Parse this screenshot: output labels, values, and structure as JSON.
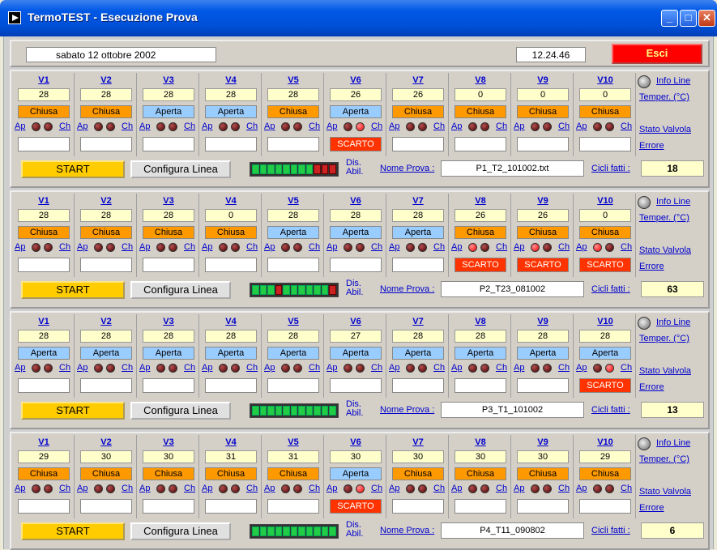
{
  "window": {
    "title": "TermoTEST - Esecuzione Prova",
    "minimize": "_",
    "maximize": "□",
    "close": "✕"
  },
  "header": {
    "date": "sabato 12 ottobre 2002",
    "time": "12.24.46",
    "exit_label": "Esci"
  },
  "labels": {
    "info_line": "Info Line",
    "temper": "Temper. (°C)",
    "stato_valvola": "Stato Valvola",
    "errore": "Errore",
    "start": "START",
    "configura": "Configura Linea",
    "dis": "Dis.",
    "abil": "Abil.",
    "nome_prova": "Nome Prova :",
    "cicli_fatti": "Cicli fatti :",
    "ap": "Ap",
    "ch": "Ch"
  },
  "colors": {
    "chiusa": "#ff9900",
    "aperta": "#99ccff",
    "scarto": "#ff3300",
    "start": "#ffcc00",
    "exit": "#ff0000"
  },
  "lines": [
    {
      "nome_prova": "P1_T2_101002.txt",
      "cicli_fatti": "18",
      "abil": [
        1,
        1,
        1,
        1,
        1,
        1,
        1,
        1,
        0,
        0,
        0
      ],
      "valves": [
        {
          "name": "V1",
          "temp": "28",
          "state": "Chiusa",
          "ap": 0,
          "ch": 0,
          "err": ""
        },
        {
          "name": "V2",
          "temp": "28",
          "state": "Chiusa",
          "ap": 0,
          "ch": 0,
          "err": ""
        },
        {
          "name": "V3",
          "temp": "28",
          "state": "Aperta",
          "ap": 0,
          "ch": 0,
          "err": ""
        },
        {
          "name": "V4",
          "temp": "28",
          "state": "Aperta",
          "ap": 0,
          "ch": 0,
          "err": ""
        },
        {
          "name": "V5",
          "temp": "28",
          "state": "Chiusa",
          "ap": 0,
          "ch": 0,
          "err": ""
        },
        {
          "name": "V6",
          "temp": "26",
          "state": "Aperta",
          "ap": 0,
          "ch": 1,
          "err": "SCARTO"
        },
        {
          "name": "V7",
          "temp": "26",
          "state": "Chiusa",
          "ap": 0,
          "ch": 0,
          "err": ""
        },
        {
          "name": "V8",
          "temp": "0",
          "state": "Chiusa",
          "ap": 0,
          "ch": 0,
          "err": ""
        },
        {
          "name": "V9",
          "temp": "0",
          "state": "Chiusa",
          "ap": 0,
          "ch": 0,
          "err": ""
        },
        {
          "name": "V10",
          "temp": "0",
          "state": "Chiusa",
          "ap": 0,
          "ch": 0,
          "err": ""
        }
      ]
    },
    {
      "nome_prova": "P2_T23_081002",
      "cicli_fatti": "63",
      "abil": [
        1,
        1,
        1,
        0,
        1,
        1,
        1,
        1,
        1,
        1,
        0
      ],
      "valves": [
        {
          "name": "V1",
          "temp": "28",
          "state": "Chiusa",
          "ap": 0,
          "ch": 0,
          "err": ""
        },
        {
          "name": "V2",
          "temp": "28",
          "state": "Chiusa",
          "ap": 0,
          "ch": 0,
          "err": ""
        },
        {
          "name": "V3",
          "temp": "28",
          "state": "Chiusa",
          "ap": 0,
          "ch": 0,
          "err": ""
        },
        {
          "name": "V4",
          "temp": "0",
          "state": "Chiusa",
          "ap": 0,
          "ch": 0,
          "err": ""
        },
        {
          "name": "V5",
          "temp": "28",
          "state": "Aperta",
          "ap": 0,
          "ch": 0,
          "err": ""
        },
        {
          "name": "V6",
          "temp": "28",
          "state": "Aperta",
          "ap": 0,
          "ch": 0,
          "err": ""
        },
        {
          "name": "V7",
          "temp": "28",
          "state": "Aperta",
          "ap": 0,
          "ch": 0,
          "err": ""
        },
        {
          "name": "V8",
          "temp": "26",
          "state": "Chiusa",
          "ap": 1,
          "ch": 0,
          "err": "SCARTO"
        },
        {
          "name": "V9",
          "temp": "26",
          "state": "Chiusa",
          "ap": 1,
          "ch": 0,
          "err": "SCARTO"
        },
        {
          "name": "V10",
          "temp": "0",
          "state": "Chiusa",
          "ap": 1,
          "ch": 0,
          "err": "SCARTO"
        }
      ]
    },
    {
      "nome_prova": "P3_T1_101002",
      "cicli_fatti": "13",
      "abil": [
        1,
        1,
        1,
        1,
        1,
        1,
        1,
        1,
        1,
        1,
        1
      ],
      "valves": [
        {
          "name": "V1",
          "temp": "28",
          "state": "Aperta",
          "ap": 0,
          "ch": 0,
          "err": ""
        },
        {
          "name": "V2",
          "temp": "28",
          "state": "Aperta",
          "ap": 0,
          "ch": 0,
          "err": ""
        },
        {
          "name": "V3",
          "temp": "28",
          "state": "Aperta",
          "ap": 0,
          "ch": 0,
          "err": ""
        },
        {
          "name": "V4",
          "temp": "28",
          "state": "Aperta",
          "ap": 0,
          "ch": 0,
          "err": ""
        },
        {
          "name": "V5",
          "temp": "28",
          "state": "Aperta",
          "ap": 0,
          "ch": 0,
          "err": ""
        },
        {
          "name": "V6",
          "temp": "27",
          "state": "Aperta",
          "ap": 0,
          "ch": 0,
          "err": ""
        },
        {
          "name": "V7",
          "temp": "28",
          "state": "Aperta",
          "ap": 0,
          "ch": 0,
          "err": ""
        },
        {
          "name": "V8",
          "temp": "28",
          "state": "Aperta",
          "ap": 0,
          "ch": 0,
          "err": ""
        },
        {
          "name": "V9",
          "temp": "28",
          "state": "Aperta",
          "ap": 0,
          "ch": 0,
          "err": ""
        },
        {
          "name": "V10",
          "temp": "28",
          "state": "Aperta",
          "ap": 0,
          "ch": 1,
          "err": "SCARTO"
        }
      ]
    },
    {
      "nome_prova": "P4_T11_090802",
      "cicli_fatti": "6",
      "abil": [
        1,
        1,
        1,
        1,
        1,
        1,
        1,
        1,
        1,
        1,
        1
      ],
      "valves": [
        {
          "name": "V1",
          "temp": "29",
          "state": "Chiusa",
          "ap": 0,
          "ch": 0,
          "err": ""
        },
        {
          "name": "V2",
          "temp": "30",
          "state": "Chiusa",
          "ap": 0,
          "ch": 0,
          "err": ""
        },
        {
          "name": "V3",
          "temp": "30",
          "state": "Chiusa",
          "ap": 0,
          "ch": 0,
          "err": ""
        },
        {
          "name": "V4",
          "temp": "31",
          "state": "Chiusa",
          "ap": 0,
          "ch": 0,
          "err": ""
        },
        {
          "name": "V5",
          "temp": "31",
          "state": "Chiusa",
          "ap": 0,
          "ch": 0,
          "err": ""
        },
        {
          "name": "V6",
          "temp": "30",
          "state": "Aperta",
          "ap": 0,
          "ch": 1,
          "err": "SCARTO"
        },
        {
          "name": "V7",
          "temp": "30",
          "state": "Chiusa",
          "ap": 0,
          "ch": 0,
          "err": ""
        },
        {
          "name": "V8",
          "temp": "30",
          "state": "Chiusa",
          "ap": 0,
          "ch": 0,
          "err": ""
        },
        {
          "name": "V9",
          "temp": "30",
          "state": "Chiusa",
          "ap": 0,
          "ch": 0,
          "err": ""
        },
        {
          "name": "V10",
          "temp": "29",
          "state": "Chiusa",
          "ap": 0,
          "ch": 0,
          "err": ""
        }
      ]
    }
  ]
}
